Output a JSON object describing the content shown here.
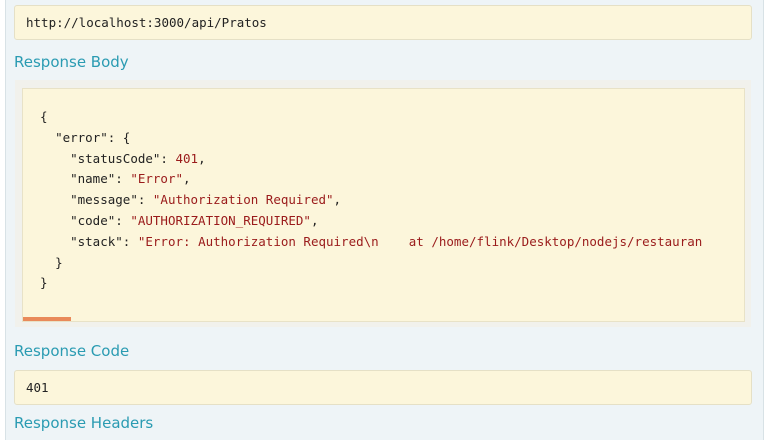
{
  "request_url": {
    "value": "http://localhost:3000/api/Pratos"
  },
  "response_body": {
    "heading": "Response Body",
    "lines": {
      "open": "{",
      "error_key": "\"error\"",
      "status_code_key": "\"statusCode\"",
      "status_code_val": "401",
      "name_key": "\"name\"",
      "name_val": "\"Error\"",
      "message_key": "\"message\"",
      "message_val": "\"Authorization Required\"",
      "code_key": "\"code\"",
      "code_val": "\"AUTHORIZATION_REQUIRED\"",
      "stack_key": "\"stack\"",
      "stack_val": "\"Error: Authorization Required\\n    at /home/flink/Desktop/nodejs/restauran",
      "inner_close": "}",
      "close": "}"
    }
  },
  "response_code": {
    "heading": "Response Code",
    "value": "401"
  },
  "response_headers": {
    "heading": "Response Headers"
  }
}
